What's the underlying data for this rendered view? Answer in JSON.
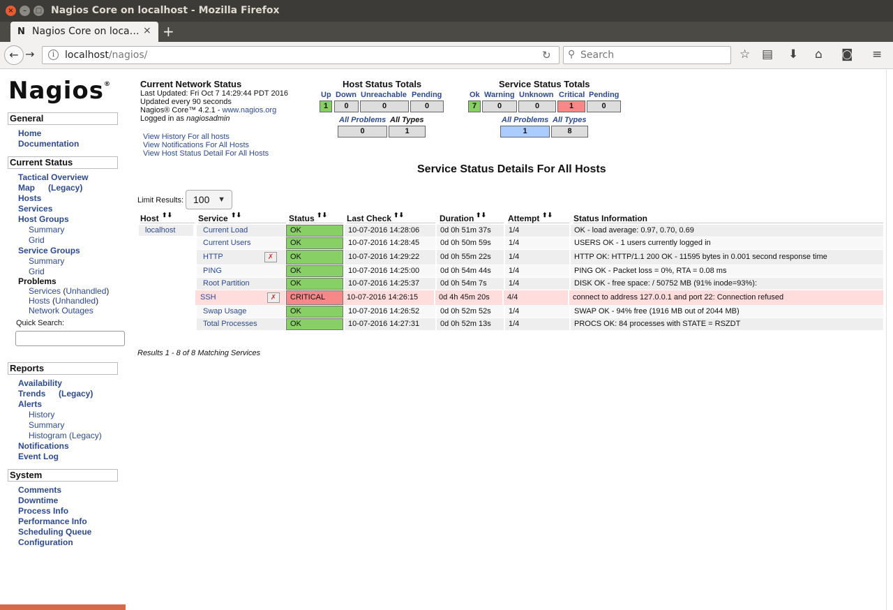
{
  "window": {
    "title": "Nagios Core on localhost - Mozilla Firefox"
  },
  "tab": {
    "favicon": "N",
    "title": "Nagios Core on loca…",
    "close": "×",
    "new": "+"
  },
  "url": {
    "host": "localhost",
    "path": "/nagios/",
    "placeholder_search": "Search"
  },
  "icons": {
    "back": "back-arrow-icon",
    "forward": "forward-arrow-icon",
    "info": "info-icon",
    "reload": "reload-icon",
    "search": "search-icon",
    "star": "bookmark-star-icon",
    "library": "library-icon",
    "download": "download-icon",
    "home": "home-icon",
    "pocket": "pocket-icon",
    "menu": "hamburger-menu-icon",
    "disabled_checks": "passive-checks-disabled-icon"
  },
  "logo": {
    "text": "Nagios",
    "mark": "®"
  },
  "sidebar": {
    "general": {
      "title": "General",
      "home": "Home",
      "documentation": "Documentation"
    },
    "current": {
      "title": "Current Status",
      "tactical": "Tactical Overview",
      "map": "Map",
      "legacy": "(Legacy)",
      "hosts": "Hosts",
      "services": "Services",
      "host_groups": "Host Groups",
      "hg_summary": "Summary",
      "hg_grid": "Grid",
      "service_groups": "Service Groups",
      "sg_summary": "Summary",
      "sg_grid": "Grid",
      "problems": "Problems",
      "p_services": "Services",
      "p_hosts": "Hosts",
      "open": "(",
      "unhandled": "Unhandled",
      "close": ")",
      "network_outages": "Network Outages",
      "quick_search": "Quick Search:"
    },
    "reports": {
      "title": "Reports",
      "availability": "Availability",
      "trends": "Trends",
      "trends_legacy": "(Legacy)",
      "alerts": "Alerts",
      "history": "History",
      "summary": "Summary",
      "histogram": "Histogram (Legacy)",
      "notifications": "Notifications",
      "event_log": "Event Log"
    },
    "system": {
      "title": "System",
      "comments": "Comments",
      "downtime": "Downtime",
      "process_info": "Process Info",
      "performance_info": "Performance Info",
      "scheduling_queue": "Scheduling Queue",
      "configuration": "Configuration"
    }
  },
  "network_status": {
    "title": "Current Network Status",
    "last_updated": "Last Updated: Fri Oct 7 14:29:44 PDT 2016",
    "updated_every": "Updated every 90 seconds",
    "version_prefix": "Nagios® Core™ 4.2.1 - ",
    "version_link": "www.nagios.org",
    "logged_prefix": "Logged in as ",
    "logged_user": "nagiosadmin",
    "links": [
      "View History For all hosts",
      "View Notifications For All Hosts",
      "View Host Status Detail For All Hosts"
    ]
  },
  "host_totals": {
    "title": "Host Status Totals",
    "headers": [
      "Up",
      "Down",
      "Unreachable",
      "Pending"
    ],
    "values": [
      "1",
      "0",
      "0",
      "0"
    ],
    "sub_headers": [
      "All Problems",
      "All Types"
    ],
    "sub_values": [
      "0",
      "1"
    ]
  },
  "service_totals": {
    "title": "Service Status Totals",
    "headers": [
      "Ok",
      "Warning",
      "Unknown",
      "Critical",
      "Pending"
    ],
    "values": [
      "7",
      "0",
      "0",
      "1",
      "0"
    ],
    "sub_headers": [
      "All Problems",
      "All Types"
    ],
    "sub_values": [
      "1",
      "8"
    ]
  },
  "details": {
    "title": "Service Status Details For All Hosts",
    "limit_label": "Limit Results:",
    "limit_value": "100",
    "columns": [
      "Host",
      "Service",
      "Status",
      "Last Check",
      "Duration",
      "Attempt",
      "Status Information"
    ],
    "sort_arrows": "⬆⬇",
    "host": "localhost",
    "rows": [
      {
        "service": "Current Load",
        "status": "OK",
        "last_check": "10-07-2016 14:28:06",
        "duration": "0d 0h 51m 37s",
        "attempt": "1/4",
        "info": "OK - load average: 0.97, 0.70, 0.69"
      },
      {
        "service": "Current Users",
        "status": "OK",
        "last_check": "10-07-2016 14:28:45",
        "duration": "0d 0h 50m 59s",
        "attempt": "1/4",
        "info": "USERS OK - 1 users currently logged in"
      },
      {
        "service": "HTTP",
        "status": "OK",
        "last_check": "10-07-2016 14:29:22",
        "duration": "0d 0h 55m 22s",
        "attempt": "1/4",
        "info": "HTTP OK: HTTP/1.1 200 OK - 11595 bytes in 0.001 second response time"
      },
      {
        "service": "PING",
        "status": "OK",
        "last_check": "10-07-2016 14:25:00",
        "duration": "0d 0h 54m 44s",
        "attempt": "1/4",
        "info": "PING OK - Packet loss = 0%, RTA = 0.08 ms"
      },
      {
        "service": "Root Partition",
        "status": "OK",
        "last_check": "10-07-2016 14:25:37",
        "duration": "0d 0h 54m 7s",
        "attempt": "1/4",
        "info": "DISK OK - free space: / 50752 MB (91% inode=93%):"
      },
      {
        "service": "SSH",
        "status": "CRITICAL",
        "last_check": "10-07-2016 14:26:15",
        "duration": "0d 4h 45m 20s",
        "attempt": "4/4",
        "info": "connect to address 127.0.0.1 and port 22: Connection refused"
      },
      {
        "service": "Swap Usage",
        "status": "OK",
        "last_check": "10-07-2016 14:26:52",
        "duration": "0d 0h 52m 52s",
        "attempt": "1/4",
        "info": "SWAP OK - 94% free (1916 MB out of 2044 MB)"
      },
      {
        "service": "Total Processes",
        "status": "OK",
        "last_check": "10-07-2016 14:27:31",
        "duration": "0d 0h 52m 13s",
        "attempt": "1/4",
        "info": "PROCS OK: 84 processes with STATE = RSZDT"
      }
    ],
    "results": "Results 1 - 8 of 8 Matching Services"
  }
}
